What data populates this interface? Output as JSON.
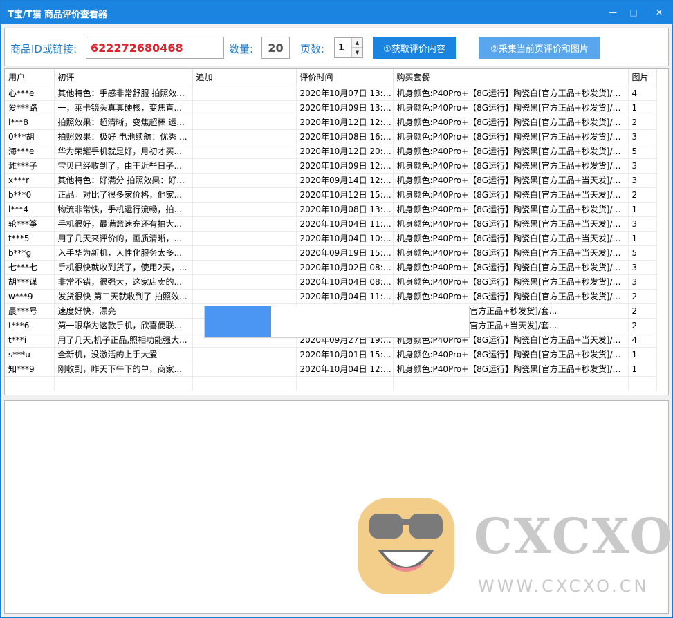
{
  "window": {
    "title": "T宝/T猫 商品评价查看器",
    "controls": {
      "minimize": "—",
      "maximize": "□",
      "close": "✕"
    }
  },
  "toolbar": {
    "id_label": "商品ID或链接:",
    "id_value": "622272680468",
    "qty_label": "数量:",
    "qty_value": "20",
    "page_label": "页数:",
    "page_value": "1",
    "fetch_label": "①获取评价内容",
    "collect_label": "②采集当前页评价和图片"
  },
  "table": {
    "columns": [
      "用户",
      "初评",
      "追加",
      "评价时间",
      "购买套餐",
      "图片"
    ],
    "rows": [
      [
        "心***e",
        "其他特色：手感非常舒服 拍照效...",
        "",
        "2020年10月07日 13:15",
        "机身颜色:P40Pro+【8G运行】陶瓷白[官方正品+秒发货]/套...",
        "4"
      ],
      [
        "爱***路",
        "一，莱卡镜头真真硬核，变焦直...",
        "",
        "2020年10月09日 13:30",
        "机身颜色:P40Pro+【8G运行】陶瓷黑[官方正品+秒发货]/套...",
        "1"
      ],
      [
        "l***8",
        "拍照效果：超清晰，变焦超棒 运...",
        "",
        "2020年10月12日 12:36",
        "机身颜色:P40Pro+【8G运行】陶瓷白[官方正品+秒发货]/套...",
        "2"
      ],
      [
        "0***胡",
        "拍照效果：极好 电池续航：优秀 ...",
        "",
        "2020年10月08日 16:42",
        "机身颜色:P40Pro+【8G运行】陶瓷黑[官方正品+秒发货]/套...",
        "3"
      ],
      [
        "海***e",
        "华为荣耀手机就是好，月初才买...",
        "",
        "2020年10月12日 20:41",
        "机身颜色:P40Pro+【8G运行】陶瓷黑[官方正品+秒发货]/套...",
        "5"
      ],
      [
        "濉***子",
        "宝贝已经收到了，由于近些日子...",
        "",
        "2020年10月09日 12:14",
        "机身颜色:P40Pro+【8G运行】陶瓷黑[官方正品+秒发货]/套...",
        "3"
      ],
      [
        "x***r",
        "其他特色：好满分 拍照效果：好...",
        "",
        "2020年09月14日 12:53",
        "机身颜色:P40Pro+【8G运行】陶瓷黑[官方正品+当天发]/套...",
        "3"
      ],
      [
        "b***0",
        "正品。对比了很多家价格，他家...",
        "",
        "2020年10月12日 15:06",
        "机身颜色:P40Pro+【8G运行】陶瓷白[官方正品+当天发]/套...",
        "2"
      ],
      [
        "l***4",
        "物流非常快，手机运行流畅，拍...",
        "",
        "2020年10月08日 13:41",
        "机身颜色:P40Pro+【8G运行】陶瓷黑[官方正品+秒发货]/套...",
        "1"
      ],
      [
        "轮***筝",
        "手机很好，最满意速充还有拍大...",
        "",
        "2020年10月04日 11:03",
        "机身颜色:P40Pro+【8G运行】陶瓷黑[官方正品+当天发]/套...",
        "3"
      ],
      [
        "t***5",
        "用了几天来评价的，画质清晰，...",
        "",
        "2020年10月04日 10:21",
        "机身颜色:P40Pro+【8G运行】陶瓷白[官方正品+当天发]/套...",
        "1"
      ],
      [
        "b***g",
        "入手华为新机，人性化服务太多...",
        "",
        "2020年09月19日 15:23",
        "机身颜色:P40Pro+【8G运行】陶瓷白[官方正品+当天发]/套...",
        "5"
      ],
      [
        "七***七",
        "手机很快就收到货了，使用2天，...",
        "",
        "2020年10月02日 08:19",
        "机身颜色:P40Pro+【8G运行】陶瓷白[官方正品+秒发货]/套...",
        "3"
      ],
      [
        "胡***谋",
        "非常不错，很强大，这家店卖的...",
        "",
        "2020年10月04日 08:58",
        "机身颜色:P40Pro+【8G运行】陶瓷黑[官方正品+秒发货]/套...",
        "3"
      ],
      [
        "w***9",
        "发货很快 第二天就收到了 拍照效...",
        "",
        "2020年10月04日 11:49",
        "机身颜色:P40Pro+【8G运行】陶瓷白[官方正品+秒发货]/套...",
        "2"
      ],
      [
        "晨***号",
        "速度好快，漂亮",
        "",
        "",
        "【8G运行】陶瓷白[官方正品+秒发货]/套...",
        "2"
      ],
      [
        "t***6",
        "第一眼华为这款手机，欣喜便联...",
        "",
        "",
        "【8G运行】陶瓷白[官方正品+当天发]/套...",
        "2"
      ],
      [
        "t***i",
        "用了几天,机子正品,照相功能强大...",
        "",
        "2020年09月27日 19:38",
        "机身颜色:P40Pro+【8G运行】陶瓷白[官方正品+当天发]/套...",
        "4"
      ],
      [
        "s***u",
        "全新机，没激活的上手大爱",
        "",
        "2020年10月01日 15:42",
        "机身颜色:P40Pro+【8G运行】陶瓷白[官方正品+秒发货]/套...",
        "1"
      ],
      [
        "知***9",
        "刚收到，昨天下午下的单，商家...",
        "",
        "2020年10月04日 12:00",
        "机身颜色:P40Pro+【8G运行】陶瓷黑[官方正品+秒发货]/套...",
        "1"
      ]
    ]
  },
  "progress": {
    "fraction": 0.25
  },
  "watermark": {
    "text": "CXCXO",
    "url": "WWW.CXCXO.CN"
  },
  "colors": {
    "accent": "#1a84e0",
    "id_text": "#e0222a",
    "label": "#1e7ccc"
  }
}
